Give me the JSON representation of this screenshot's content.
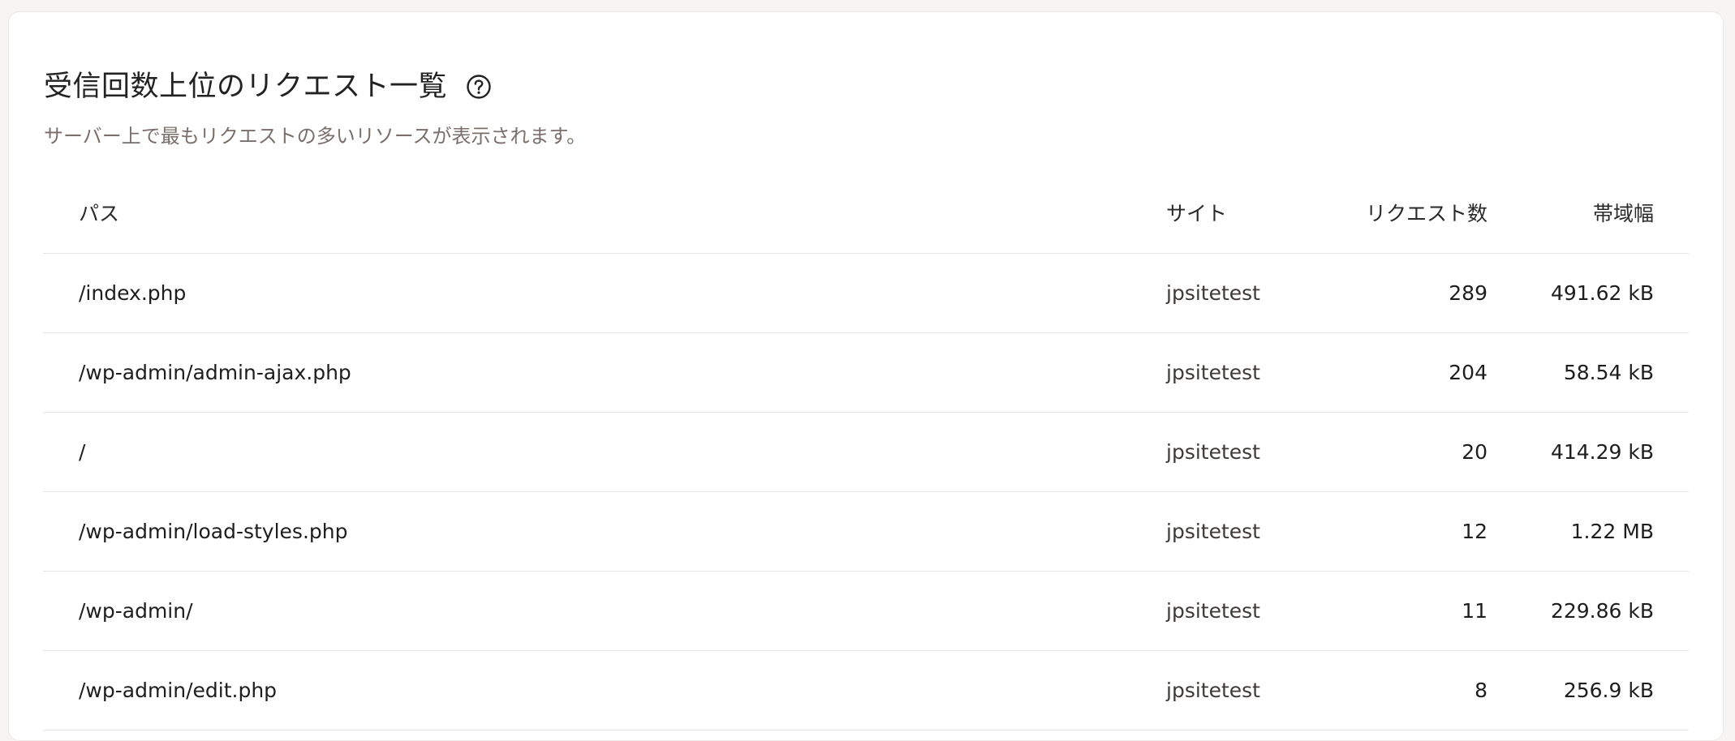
{
  "section": {
    "title": "受信回数上位のリクエスト一覧",
    "help_icon": "question-circle-icon",
    "subtitle": "サーバー上で最もリクエストの多いリソースが表示されます。"
  },
  "table": {
    "columns": {
      "path": "パス",
      "site": "サイト",
      "requests": "リクエスト数",
      "bandwidth": "帯域幅"
    },
    "rows": [
      {
        "path": "/index.php",
        "site": "jpsitetest",
        "requests": "289",
        "bandwidth": "491.62 kB"
      },
      {
        "path": "/wp-admin/admin-ajax.php",
        "site": "jpsitetest",
        "requests": "204",
        "bandwidth": "58.54 kB"
      },
      {
        "path": "/",
        "site": "jpsitetest",
        "requests": "20",
        "bandwidth": "414.29 kB"
      },
      {
        "path": "/wp-admin/load-styles.php",
        "site": "jpsitetest",
        "requests": "12",
        "bandwidth": "1.22 MB"
      },
      {
        "path": "/wp-admin/",
        "site": "jpsitetest",
        "requests": "11",
        "bandwidth": "229.86 kB"
      },
      {
        "path": "/wp-admin/edit.php",
        "site": "jpsitetest",
        "requests": "8",
        "bandwidth": "256.9 kB"
      }
    ]
  },
  "colors": {
    "background": "#f7f5f3",
    "card": "#ffffff",
    "subtitle_text": "#7a6f6b",
    "divider": "#e6e3e0"
  }
}
